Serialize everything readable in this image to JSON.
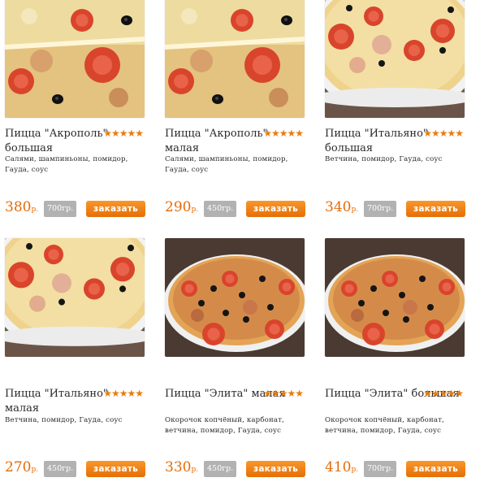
{
  "products": [
    {
      "title": "Пицца \"Акрополь\" большая",
      "desc": "Салями, шампиньоны, помидор, Гауда, соус",
      "price": "380",
      "currency": "р.",
      "weight": "700гр.",
      "order_label": "заказать",
      "rating": "★★★★★",
      "photo": "akropol"
    },
    {
      "title": "Пицца \"Акрополь\" малая",
      "desc": "Салями, шампиньоны, помидор, Гауда, соус",
      "price": "290",
      "currency": "р.",
      "weight": "450гр.",
      "order_label": "заказать",
      "rating": "★★★★★",
      "photo": "akropol"
    },
    {
      "title": "Пицца \"Итальяно\" большая",
      "desc": "Ветчина, помидор, Гауда, соус",
      "price": "340",
      "currency": "р.",
      "weight": "700гр.",
      "order_label": "заказать",
      "rating": "★★★★★",
      "photo": "italiano"
    },
    {
      "title": "Пицца \"Итальяно\" малая",
      "desc": "Ветчина, помидор, Гауда, соус",
      "price": "270",
      "currency": "р.",
      "weight": "450гр.",
      "order_label": "заказать",
      "rating": "★★★★★",
      "photo": "italiano2"
    },
    {
      "title": "Пицца \"Элита\" малая",
      "desc": "Окорочок копчёный, карбонат, ветчина, помидор, Гауда, соус",
      "price": "330",
      "currency": "р.",
      "weight": "450гр.",
      "order_label": "заказать",
      "rating": "★★★★★",
      "photo": "elita"
    },
    {
      "title": "Пицца \"Элита\" большая",
      "desc": "Окорочок копчёный, карбонат, ветчина, помидор, Гауда, соус",
      "price": "410",
      "currency": "р.",
      "weight": "700гр.",
      "order_label": "заказать",
      "rating": "★★★★★",
      "photo": "elita"
    }
  ]
}
